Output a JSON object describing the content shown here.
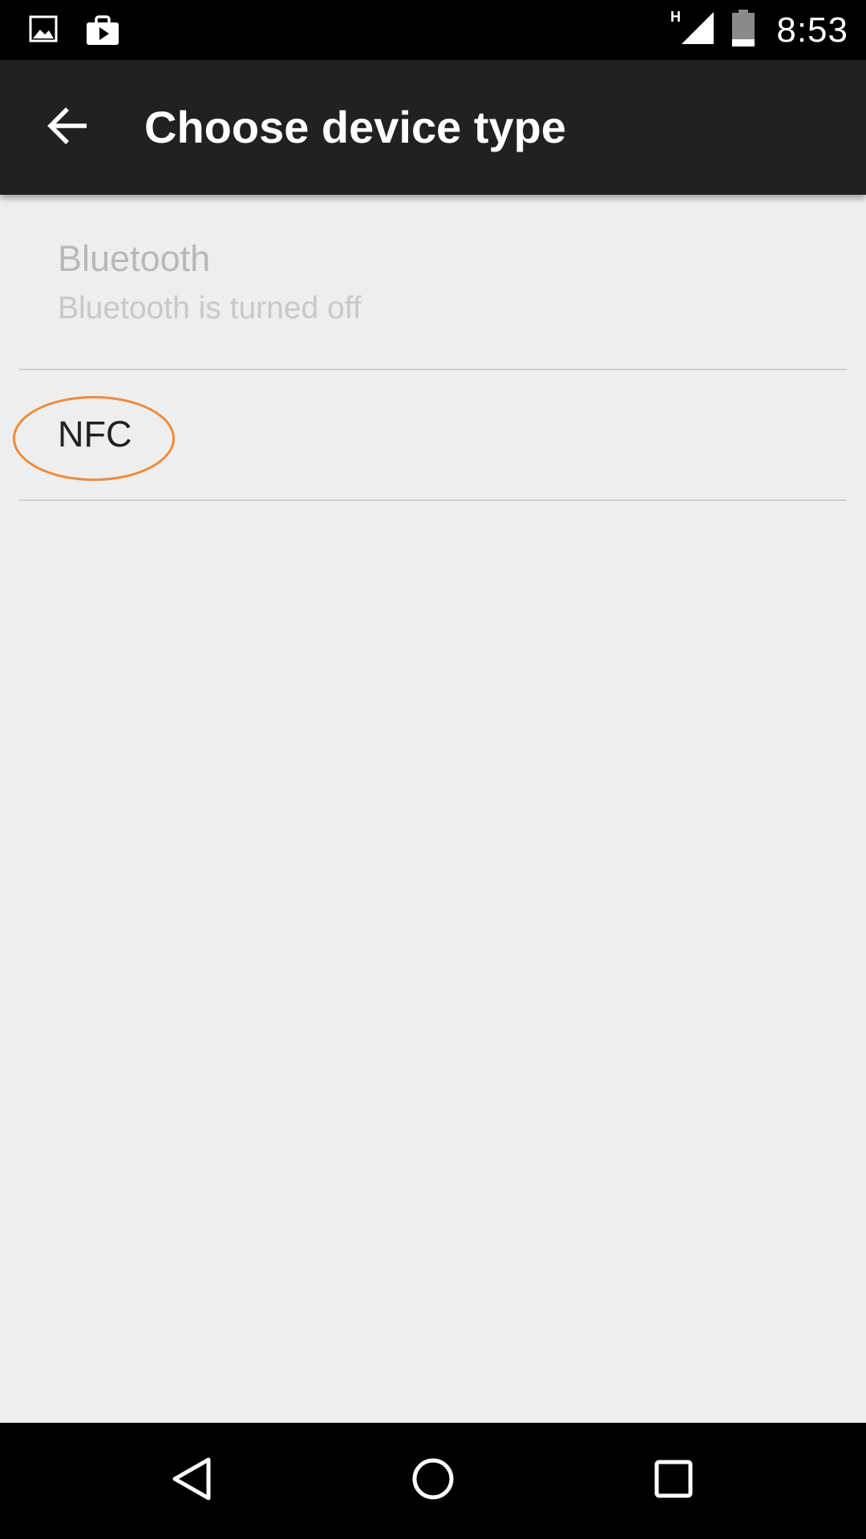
{
  "status_bar": {
    "time": "8:53",
    "network_type": "H",
    "icons": [
      "image-icon",
      "play-store-icon",
      "signal-icon",
      "battery-icon"
    ]
  },
  "app_bar": {
    "title": "Choose device type",
    "back_icon": "arrow-back-icon"
  },
  "list": {
    "items": [
      {
        "title": "Bluetooth",
        "summary": "Bluetooth is turned off",
        "enabled": false
      },
      {
        "title": "NFC",
        "summary": "",
        "enabled": true
      }
    ]
  },
  "nav_bar": {
    "icons": [
      "nav-back-icon",
      "nav-home-icon",
      "nav-recents-icon"
    ]
  },
  "colors": {
    "status_bar": "#000000",
    "app_bar": "#212121",
    "background": "#eeeeee",
    "disabled_text": "#b8b8b8",
    "primary_text": "#212121",
    "highlight": "#ef8a3a"
  }
}
